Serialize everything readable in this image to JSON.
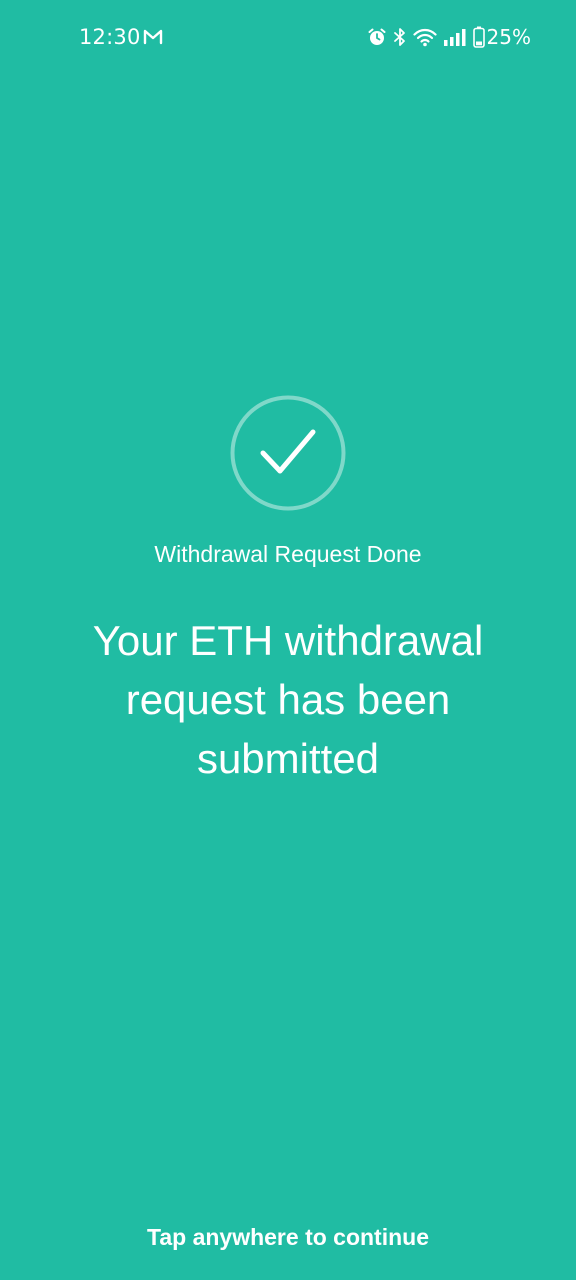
{
  "colors": {
    "background": "#20BCA3",
    "foreground": "#FFFFFF",
    "ring": "#7FD8C9"
  },
  "status_bar": {
    "time": "12:30",
    "battery_percent": "25%",
    "icons": [
      "gmail-icon",
      "alarm-icon",
      "bluetooth-icon",
      "wifi-icon",
      "signal-icon",
      "battery-icon"
    ]
  },
  "result": {
    "icon": "checkmark-icon",
    "label": "Withdrawal Request Done",
    "message": "Your ETH withdrawal request has been submitted"
  },
  "footer": {
    "hint": "Tap anywhere to continue"
  }
}
